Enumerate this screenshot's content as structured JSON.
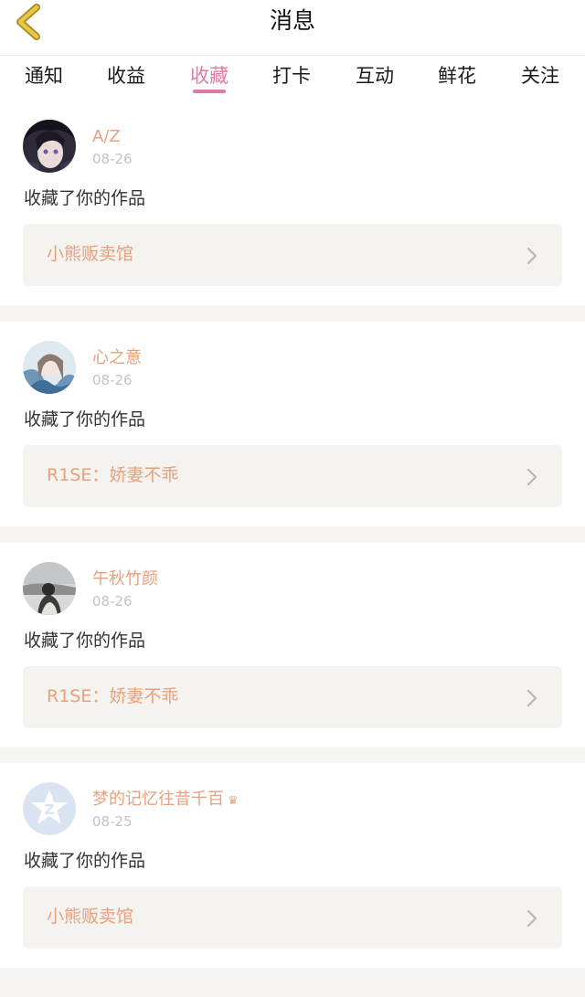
{
  "header": {
    "title": "消息",
    "back_icon": "chevron-left-icon",
    "back_color": "#d8b836"
  },
  "tabs": [
    {
      "label": "通知",
      "active": false
    },
    {
      "label": "收益",
      "active": false
    },
    {
      "label": "收藏",
      "active": true
    },
    {
      "label": "打卡",
      "active": false
    },
    {
      "label": "互动",
      "active": false
    },
    {
      "label": "鲜花",
      "active": false
    },
    {
      "label": "关注",
      "active": false
    }
  ],
  "colors": {
    "accent": "#e07aa8",
    "name": "#e8a07d",
    "date": "#c3c3c3",
    "card_box": "#f4f3ef",
    "divider": "#f7f5f4"
  },
  "messages": [
    {
      "username": "A/Z",
      "date": "08-26",
      "action": "收藏了你的作品",
      "work_title": "小熊贩卖馆",
      "avatar": "anime-character-avatar"
    },
    {
      "username": "心之意",
      "date": "08-26",
      "action": "收藏了你的作品",
      "work_title": "R1SE：娇妻不乖",
      "avatar": "anime-girl-avatar"
    },
    {
      "username": "午秋竹颜",
      "date": "08-26",
      "action": "收藏了你的作品",
      "work_title": "R1SE：娇妻不乖",
      "avatar": "photo-avatar"
    },
    {
      "username": "梦的记忆往昔千百",
      "badge": "♛",
      "date": "08-25",
      "action": "收藏了你的作品",
      "work_title": "小熊贩卖馆",
      "avatar": "default-star-avatar"
    }
  ]
}
